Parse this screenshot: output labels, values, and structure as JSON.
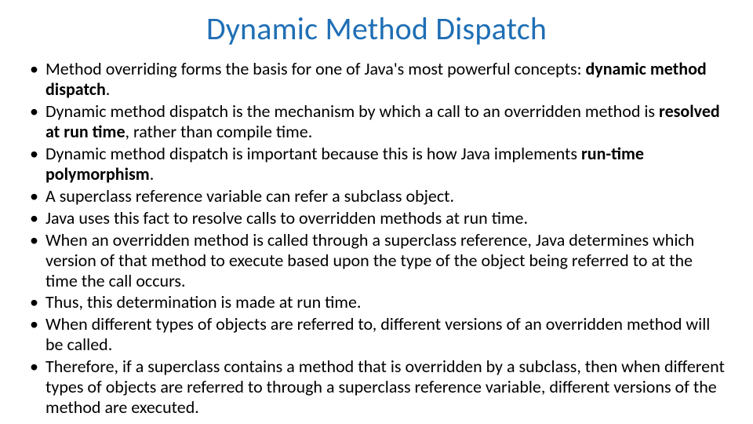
{
  "slide": {
    "title": "Dynamic Method Dispatch",
    "bullets": [
      {
        "runs": [
          {
            "text": "Method overriding forms the basis for one of Java's most powerful concepts: ",
            "bold": false
          },
          {
            "text": "dynamic method dispatch",
            "bold": true
          },
          {
            "text": ".",
            "bold": false
          }
        ]
      },
      {
        "runs": [
          {
            "text": "Dynamic method dispatch is the mechanism by which a call to an overridden method is ",
            "bold": false
          },
          {
            "text": "resolved at run time",
            "bold": true
          },
          {
            "text": ", rather than compile time.",
            "bold": false
          }
        ]
      },
      {
        "runs": [
          {
            "text": "Dynamic method dispatch is important because this is how Java implements ",
            "bold": false
          },
          {
            "text": "run-time polymorphism",
            "bold": true
          },
          {
            "text": ".",
            "bold": false
          }
        ]
      },
      {
        "runs": [
          {
            "text": "A superclass reference variable can refer a subclass object.",
            "bold": false
          }
        ]
      },
      {
        "runs": [
          {
            "text": "Java uses this fact to resolve calls to overridden methods at run time.",
            "bold": false
          }
        ]
      },
      {
        "runs": [
          {
            "text": "When an overridden method is called through a superclass reference, Java determines which version of that method to execute based upon the type of the object being referred to at the time the call occurs.",
            "bold": false
          }
        ]
      },
      {
        "runs": [
          {
            "text": "Thus, this determination is made at run time.",
            "bold": false
          }
        ]
      },
      {
        "runs": [
          {
            "text": "When different types of objects are referred to, different versions of an overridden method will be called.",
            "bold": false
          }
        ]
      },
      {
        "runs": [
          {
            "text": "Therefore, if a superclass contains a method that is overridden by a subclass, then when different types of objects are referred to through a superclass reference variable, different versions of the method are executed.",
            "bold": false
          }
        ]
      }
    ]
  }
}
